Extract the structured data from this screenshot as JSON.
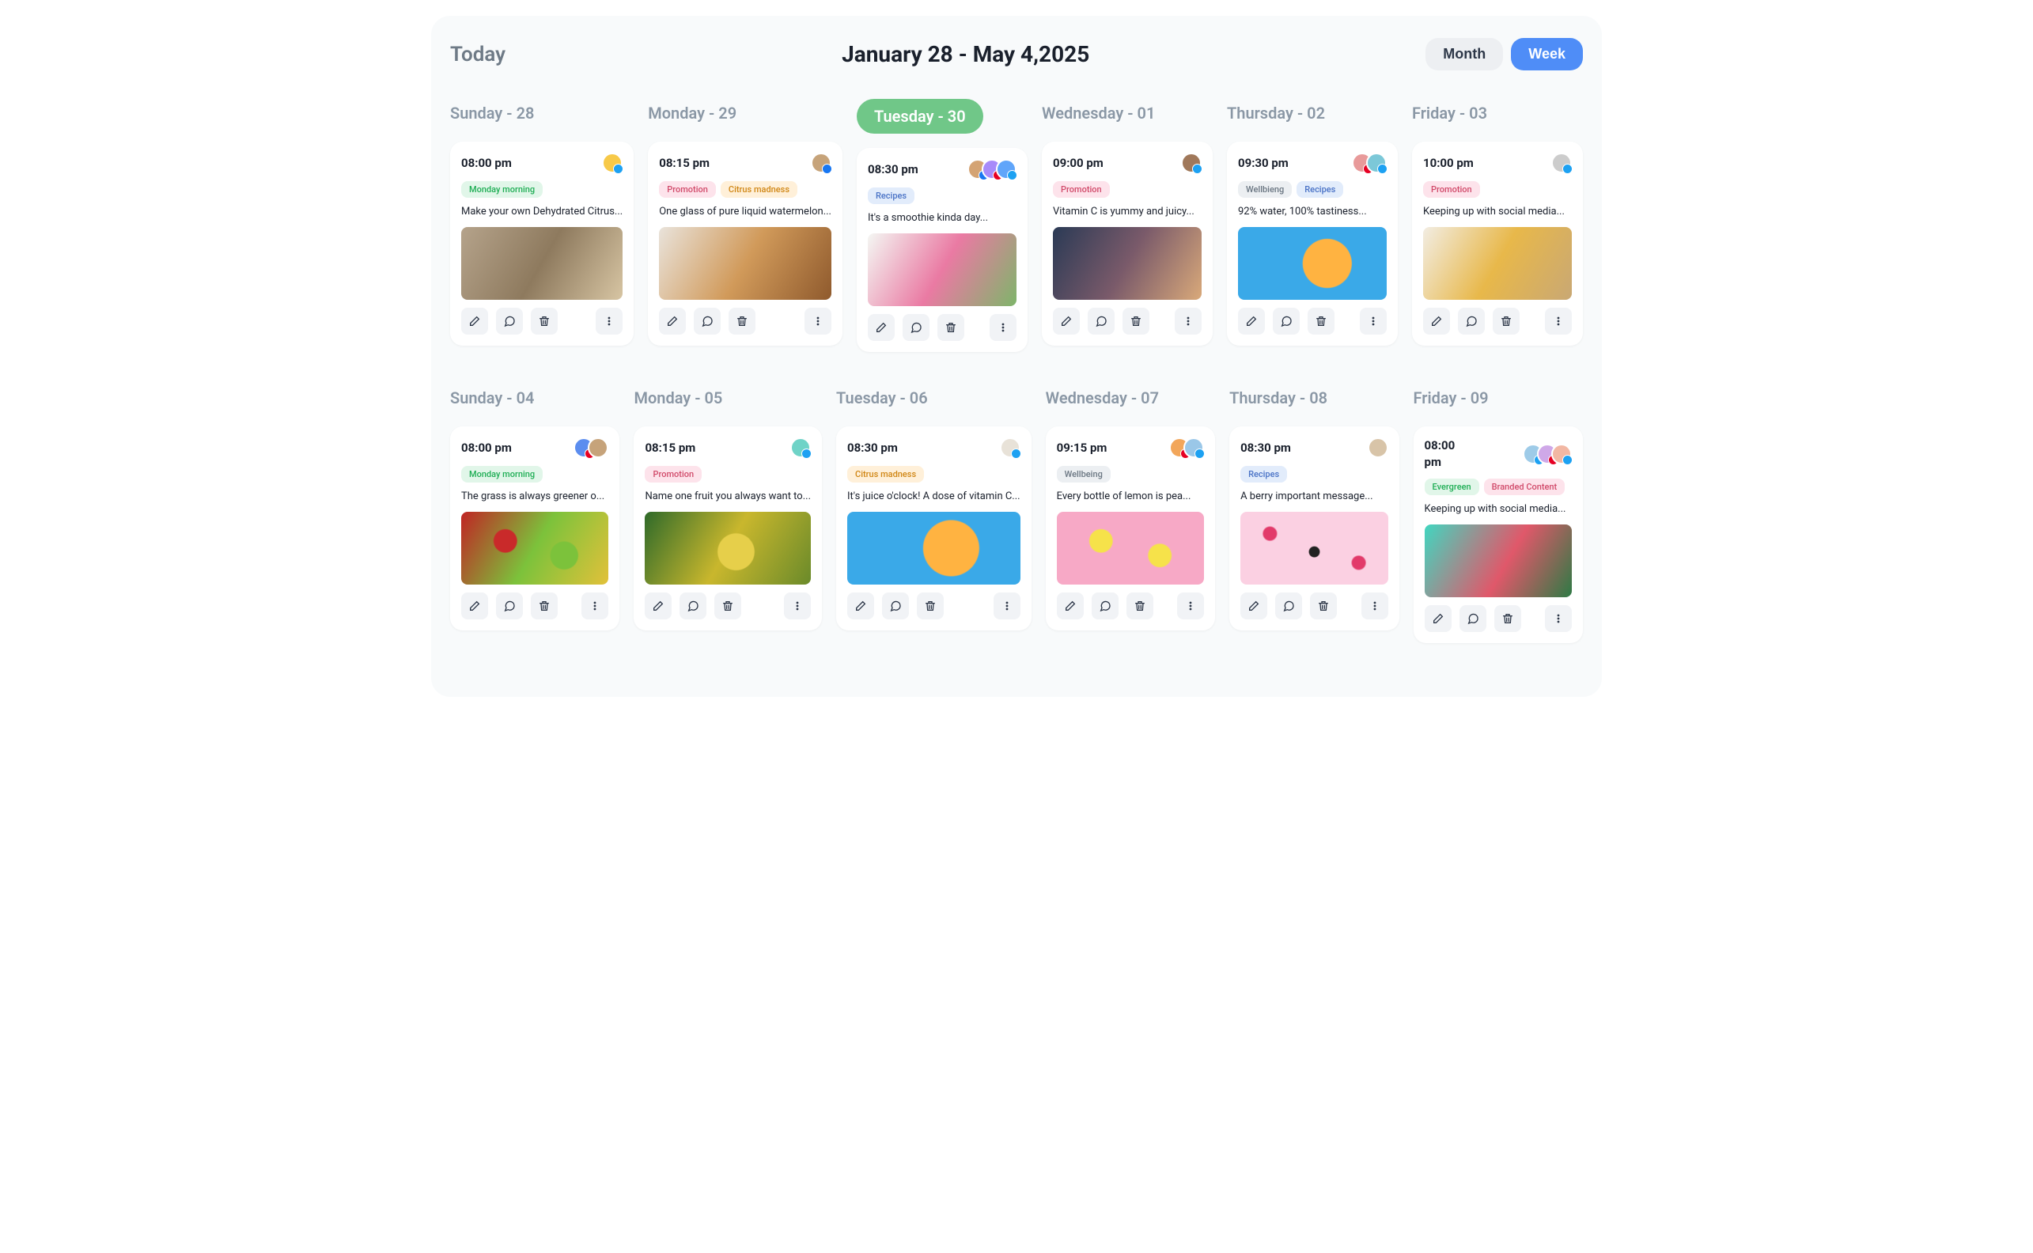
{
  "header": {
    "today": "Today",
    "range": "January 28 - May 4,2025",
    "views": {
      "month": "Month",
      "week": "Week"
    },
    "active_view": "week"
  },
  "tag_colors": {
    "Monday morning": "green",
    "Promotion": "pink",
    "Citrus madness": "orange",
    "Recipes": "blue",
    "Wellbieng": "gray",
    "Wellbeing": "gray",
    "Evergreen": "green",
    "Branded Content": "pink"
  },
  "image_styles": {
    "dogs": "linear-gradient(120deg,#b5a38b,#8e7a5e,#d7c5a3)",
    "cat": "linear-gradient(120deg,#e9e3db,#d19a5a,#8f5a2d)",
    "tulips": "linear-gradient(120deg,#f4f7f3,#ea7aa3,#7eb56a)",
    "mountains": "linear-gradient(120deg,#2a3a55,#7a5a6a,#d9a97a)",
    "orange-blue": "radial-gradient(circle at 60% 50%, #ffb341 0 25%, #3aa9e8 26% 100%)",
    "livingroom": "linear-gradient(120deg,#f2ede3,#e8b84a,#c9a874)",
    "apples": "radial-gradient(circle at 30% 40%, #c92a2a 0 10%, transparent 11%), radial-gradient(circle at 70% 60%, #7cc23b 0 12%, transparent 13%), linear-gradient(120deg,#c02424,#7cc23b,#e2c13a)",
    "grapes": "radial-gradient(circle at 55% 55%, #e6cf4a 0 18%, transparent 19%), linear-gradient(120deg,#2f6a2a,#c9b72d,#6a8a2a)",
    "doctor": "linear-gradient(120deg,#eef0f4,#d8dee6)",
    "lemons-pink": "radial-gradient(circle at 30% 40%, #f6e24a 0 10%, transparent 11%), radial-gradient(circle at 70% 60%, #f6e24a 0 10%, transparent 11%), linear-gradient(#f7a9c6,#f7a9c6)",
    "berries-pink": "radial-gradient(circle at 20% 30%, #e23a6a 0 5%, transparent 6%), radial-gradient(circle at 50% 55%, #222 0 6%, transparent 7%), radial-gradient(circle at 80% 70%, #e23a6a 0 5%, transparent 6%), linear-gradient(#fbd0e2,#fbd0e2)",
    "watermelon": "linear-gradient(120deg,#41d6c0,#e0586a 55%,#2e7a45)"
  },
  "weeks": [
    {
      "days": [
        {
          "label": "Sunday - 28",
          "active": false,
          "card": {
            "time": "08:00 pm",
            "avatars": [
              {
                "bg": "#f7c948",
                "badge": "tw"
              }
            ],
            "tags": [
              "Monday morning"
            ],
            "desc": "Make your own Dehydrated Citrus...",
            "image": "dogs"
          }
        },
        {
          "label": "Monday - 29",
          "active": false,
          "card": {
            "time": "08:15 pm",
            "avatars": [
              {
                "bg": "#c6a37a",
                "badge": "fb"
              }
            ],
            "tags": [
              "Promotion",
              "Citrus madness"
            ],
            "desc": "One glass of pure liquid watermelon...",
            "image": "cat"
          }
        },
        {
          "label": "Tuesday - 30",
          "active": true,
          "card": {
            "time": "08:30 pm",
            "avatars": [
              {
                "bg": "#d4a373",
                "badge": "fb"
              },
              {
                "bg": "#a78bfa",
                "badge": "pn"
              },
              {
                "bg": "#60a5fa",
                "badge": "tw"
              }
            ],
            "tags": [
              "Recipes"
            ],
            "desc": "It's a smoothie kinda day...",
            "image": "tulips"
          }
        },
        {
          "label": "Wednesday - 01",
          "active": false,
          "card": {
            "time": "09:00 pm",
            "avatars": [
              {
                "bg": "#a0785a",
                "badge": "tw"
              }
            ],
            "tags": [
              "Promotion"
            ],
            "desc": "Vitamin C is yummy and juicy...",
            "image": "mountains"
          }
        },
        {
          "label": "Thursday - 02",
          "active": false,
          "card": {
            "time": "09:30 pm",
            "avatars": [
              {
                "bg": "#e89a9a",
                "badge": "pn"
              },
              {
                "bg": "#7cc8d8",
                "badge": "tw"
              }
            ],
            "tags": [
              "Wellbieng",
              "Recipes"
            ],
            "desc": "92% water, 100% tastiness...",
            "image": "orange-blue"
          }
        },
        {
          "label": "Friday - 03",
          "active": false,
          "card": {
            "time": "10:00 pm",
            "avatars": [
              {
                "bg": "#cccccc",
                "badge": "tw"
              }
            ],
            "tags": [
              "Promotion"
            ],
            "desc": "Keeping up with social media...",
            "image": "livingroom"
          }
        }
      ]
    },
    {
      "days": [
        {
          "label": "Sunday - 04",
          "active": false,
          "card": {
            "time": "08:00 pm",
            "avatars": [
              {
                "bg": "#5b8def",
                "badge": "pn"
              },
              {
                "bg": "#c6a37a",
                "badge": ""
              }
            ],
            "tags": [
              "Monday morning"
            ],
            "desc": "The grass is always greener o...",
            "image": "apples"
          }
        },
        {
          "label": "Monday - 05",
          "active": false,
          "card": {
            "time": "08:15 pm",
            "avatars": [
              {
                "bg": "#6fd3c7",
                "badge": "tw"
              }
            ],
            "tags": [
              "Promotion"
            ],
            "desc": "Name one fruit you always want to...",
            "image": "grapes"
          }
        },
        {
          "label": "Tuesday - 06",
          "active": false,
          "card": {
            "time": "08:30 pm",
            "avatars": [
              {
                "bg": "#e8e2d8",
                "badge": "tw"
              }
            ],
            "tags": [
              "Citrus madness"
            ],
            "desc": "It's juice o'clock! A dose of vitamin C...",
            "image": "orange-blue"
          }
        },
        {
          "label": "Wednesday - 07",
          "active": false,
          "card": {
            "time": "09:15 pm",
            "avatars": [
              {
                "bg": "#f2a65a",
                "badge": "pn"
              },
              {
                "bg": "#9ac7e8",
                "badge": "tw"
              }
            ],
            "tags": [
              "Wellbeing"
            ],
            "desc": "Every bottle of lemon is pea...",
            "image": "lemons-pink"
          }
        },
        {
          "label": "Thursday - 08",
          "active": false,
          "card": {
            "time": "08:30 pm",
            "avatars": [
              {
                "bg": "#d8c4a8",
                "badge": ""
              }
            ],
            "tags": [
              "Recipes"
            ],
            "desc": "A berry important message...",
            "image": "berries-pink"
          }
        },
        {
          "label": "Friday - 09",
          "active": false,
          "card": {
            "time": "08:00 pm",
            "time_wrap": true,
            "avatars": [
              {
                "bg": "#9ecbe8",
                "badge": "tw"
              },
              {
                "bg": "#cfa8e8",
                "badge": "pn"
              },
              {
                "bg": "#f2b7a3",
                "badge": "tw"
              }
            ],
            "tags": [
              "Evergreen",
              "Branded Content"
            ],
            "desc": "Keeping up with social media...",
            "image": "watermelon"
          }
        }
      ]
    }
  ],
  "actions": [
    "edit",
    "comment",
    "delete",
    "more"
  ]
}
